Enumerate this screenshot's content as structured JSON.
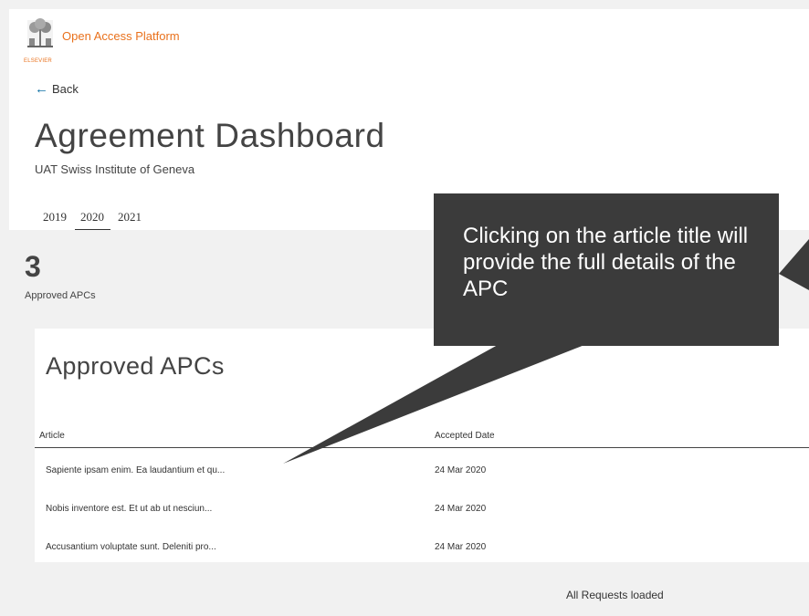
{
  "header": {
    "logo_text": "ELSEVIER",
    "brand": "Open Access Platform"
  },
  "nav": {
    "back_label": "Back"
  },
  "page": {
    "title": "Agreement Dashboard",
    "subtitle": "UAT Swiss Institute of Geneva"
  },
  "years": [
    {
      "label": "2019",
      "active": false
    },
    {
      "label": "2020",
      "active": true
    },
    {
      "label": "2021",
      "active": false
    }
  ],
  "stats": {
    "count": "3",
    "count_label": "Approved APCs"
  },
  "table": {
    "title": "Approved APCs",
    "columns": [
      "Article",
      "Accepted Date"
    ],
    "rows": [
      {
        "article": "Sapiente ipsam enim. Ea laudantium et qu...",
        "date": "24 Mar 2020"
      },
      {
        "article": "Nobis inventore est. Et ut ab ut nesciun...",
        "date": "24 Mar 2020"
      },
      {
        "article": "Accusantium voluptate sunt. Deleniti pro...",
        "date": "24 Mar 2020"
      }
    ]
  },
  "footer": {
    "status": "All Requests loaded"
  },
  "callout": {
    "text": "Clicking on the article title will provide the full details of the APC"
  },
  "colors": {
    "brand": "#e9711c",
    "callout_bg": "#3b3b3b",
    "accent_link": "#0b6fa4"
  }
}
